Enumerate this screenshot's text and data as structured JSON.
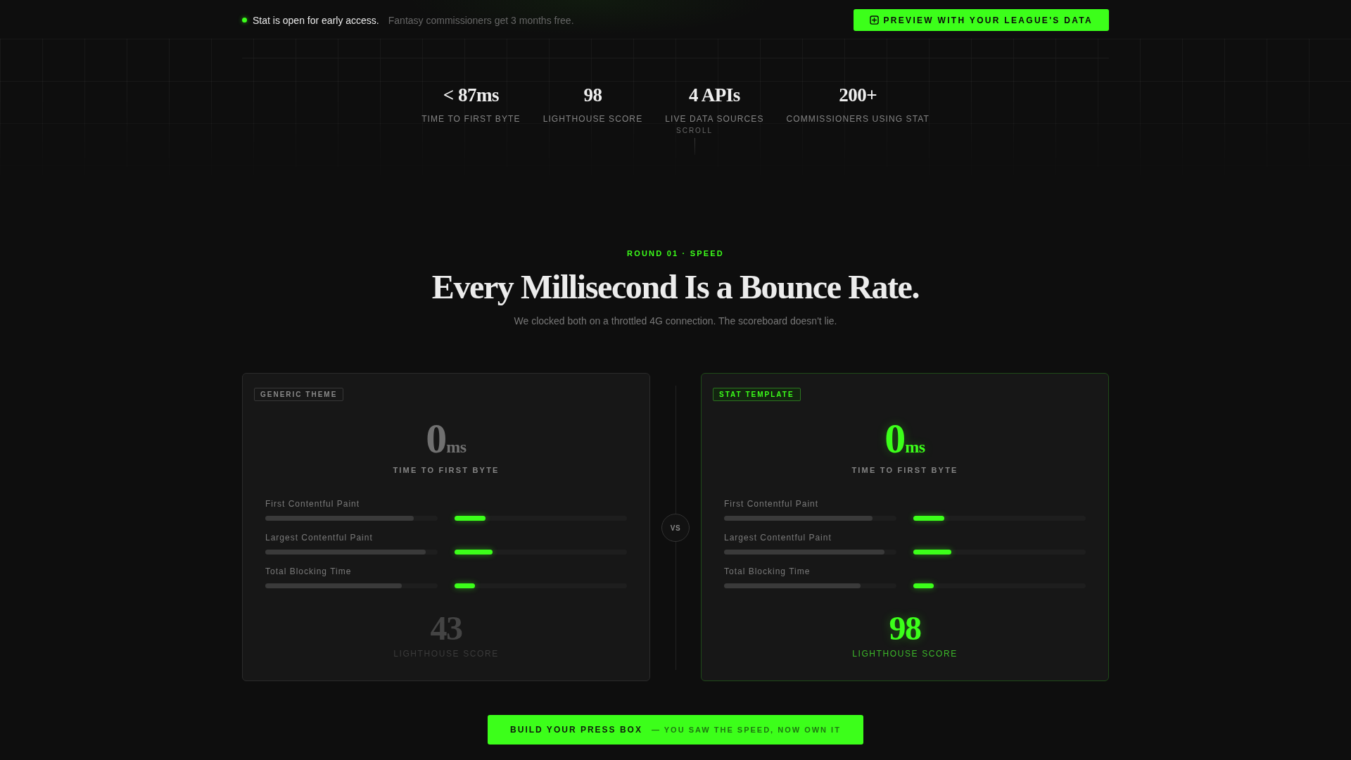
{
  "announcement": {
    "headline": "Stat is open for early access.",
    "detail": "Fantasy commissioners get 3 months free.",
    "button": "PREVIEW WITH YOUR LEAGUE'S DATA"
  },
  "stats": [
    {
      "value": "< 87ms",
      "label": "TIME TO FIRST BYTE"
    },
    {
      "value": "98",
      "label": "LIGHTHOUSE SCORE"
    },
    {
      "value": "4 APIs",
      "label": "LIVE DATA SOURCES"
    },
    {
      "value": "200+",
      "label": "COMMISSIONERS USING STAT"
    }
  ],
  "scroll_hint": "SCROLL",
  "section": {
    "eyebrow": "ROUND 01 · SPEED",
    "title": "Every Millisecond Is a Bounce Rate.",
    "subtitle": "We clocked both on a throttled 4G connection. The scoreboard doesn't lie."
  },
  "comparison": {
    "divider": "VS",
    "cards": [
      {
        "kind": "generic",
        "tag": "GENERIC THEME",
        "ttfb": {
          "value": "0",
          "unit": "ms",
          "label": "TIME TO FIRST BYTE"
        },
        "metrics": [
          {
            "label": "First Contentful Paint",
            "bars": [
              {
                "kind": "baseline",
                "level": 0.86
              },
              {
                "kind": "accent",
                "level": 0.18
              }
            ]
          },
          {
            "label": "Largest Contentful Paint",
            "bars": [
              {
                "kind": "baseline",
                "level": 0.93
              },
              {
                "kind": "accent",
                "level": 0.22
              }
            ]
          },
          {
            "label": "Total Blocking Time",
            "bars": [
              {
                "kind": "baseline",
                "level": 0.79
              },
              {
                "kind": "accent",
                "level": 0.12
              }
            ]
          }
        ],
        "score": {
          "value": "43",
          "label": "LIGHTHOUSE SCORE"
        }
      },
      {
        "kind": "stat",
        "tag": "STAT TEMPLATE",
        "ttfb": {
          "value": "0",
          "unit": "ms",
          "label": "TIME TO FIRST BYTE"
        },
        "metrics": [
          {
            "label": "First Contentful Paint",
            "bars": [
              {
                "kind": "baseline",
                "level": 0.86
              },
              {
                "kind": "accent",
                "level": 0.18
              }
            ]
          },
          {
            "label": "Largest Contentful Paint",
            "bars": [
              {
                "kind": "baseline",
                "level": 0.93
              },
              {
                "kind": "accent",
                "level": 0.22
              }
            ]
          },
          {
            "label": "Total Blocking Time",
            "bars": [
              {
                "kind": "baseline",
                "level": 0.79
              },
              {
                "kind": "accent",
                "level": 0.12
              }
            ]
          }
        ],
        "score": {
          "value": "98",
          "label": "LIGHTHOUSE SCORE"
        }
      }
    ]
  },
  "cta": {
    "label": "BUILD YOUR PRESS BOX",
    "tagline": "— YOU SAW THE SPEED, NOW OWN IT"
  }
}
